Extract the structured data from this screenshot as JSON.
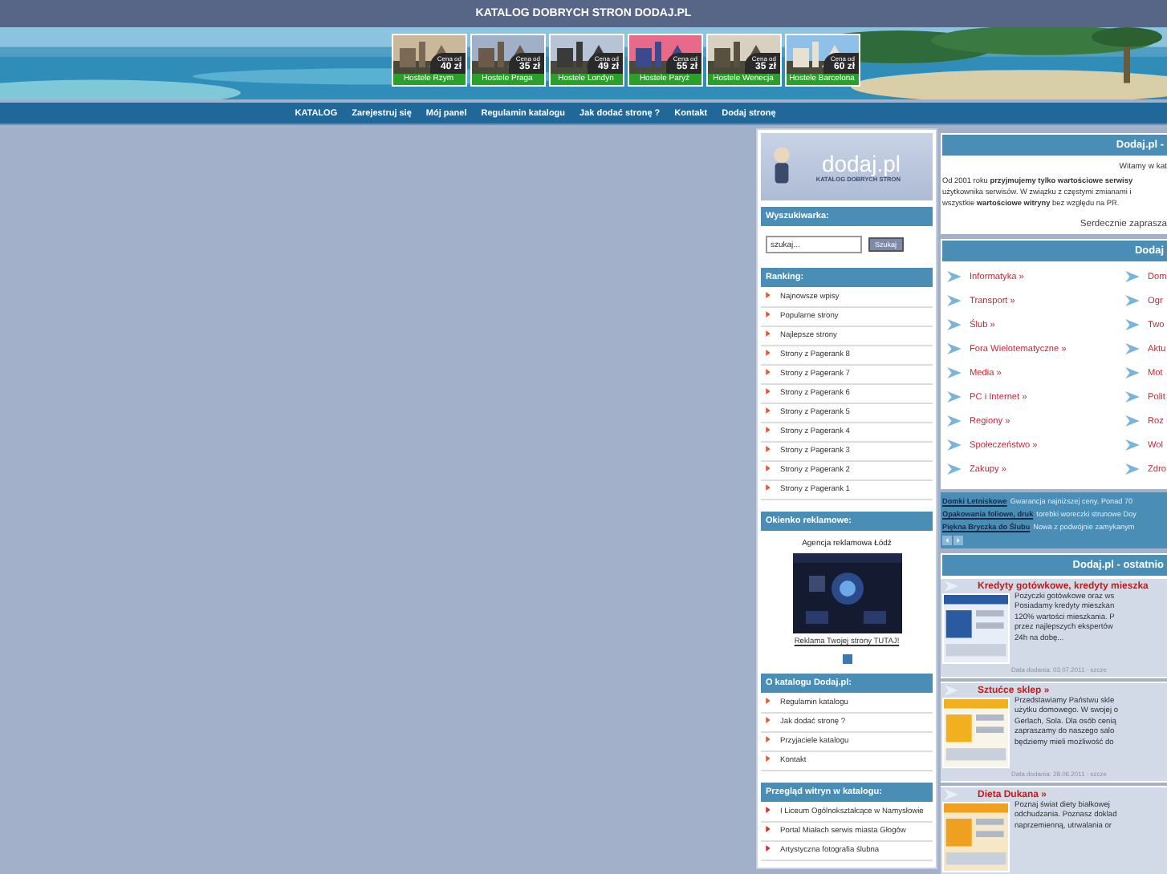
{
  "header": {
    "title": "KATALOG DOBRYCH STRON DODAJ.PL",
    "hostels": [
      {
        "price_label": "Cena od",
        "price": "40 zł",
        "label": "Hostele Rzym"
      },
      {
        "price_label": "Cena od",
        "price": "35 zł",
        "label": "Hostele Praga"
      },
      {
        "price_label": "Cena od",
        "price": "49 zł",
        "label": "Hostele Londyn"
      },
      {
        "price_label": "Cena od",
        "price": "55 zł",
        "label": "Hostele Paryż"
      },
      {
        "price_label": "Cena od",
        "price": "35 zł",
        "label": "Hostele Wenecja"
      },
      {
        "price_label": "Cena od",
        "price": "60 zł",
        "label": "Hostele Barcelona"
      }
    ]
  },
  "nav": [
    "KATALOG",
    "Zarejestruj się",
    "Mój panel",
    "Regulamin katalogu",
    "Jak dodać stronę ?",
    "Kontakt",
    "Dodaj stronę"
  ],
  "sidebar": {
    "logo": {
      "name": "dodaj.pl",
      "tagline": "KATALOG DOBRYCH STRON"
    },
    "search": {
      "heading": "Wyszukiwarka:",
      "placeholder": "szukaj...",
      "button": "Szukaj"
    },
    "ranking": {
      "heading": "Ranking:",
      "items": [
        "Najnowsze wpisy",
        "Popularne strony",
        "Najlepsze strony",
        "Strony z Pagerank 8",
        "Strony z Pagerank 7",
        "Strony z Pagerank 6",
        "Strony z Pagerank 5",
        "Strony z Pagerank 4",
        "Strony z Pagerank 3",
        "Strony z Pagerank 2",
        "Strony z Pagerank 1"
      ]
    },
    "ad": {
      "heading": "Okienko reklamowe:",
      "caption": "Agencja reklamowa Łódź",
      "link": "Reklama Twojej strony TUTAJ!"
    },
    "about": {
      "heading": "O katalogu Dodaj.pl:",
      "items": [
        "Regulamin katalogu",
        "Jak dodać stronę ?",
        "Przyjaciele katalogu",
        "Kontakt"
      ]
    },
    "review": {
      "heading": "Przegląd witryn w katalogu:",
      "items": [
        "I Liceum Ogólnokształcące w Namysłowie",
        "Portal Miałach serwis miasta Głogów",
        "Artystyczna fotografia ślubna"
      ]
    }
  },
  "main": {
    "welcome": {
      "heading": "Dodaj.pl -",
      "greeting": "Witamy w kat",
      "text": "Od 2001 roku **przyjmujemy tylko wartościowe serwisy**\nużytkownika serwisów. W związku z częstymi zmianami i\nwszystkie **wartościowe witryny** bez względu na PR.",
      "closing": "Serdecznie zaprasza"
    },
    "categories": {
      "heading": "Dodaj",
      "left": [
        "Informatyka »",
        "Transport »",
        "Ślub »",
        "Fora Wielotematyczne »",
        "Media »",
        "PC i Internet »",
        "Regiony »",
        "Społeczeństwo »",
        "Zakupy »"
      ],
      "right": [
        "Dom",
        "Ogr",
        "Two",
        "Aktu",
        "Mot",
        "Polit",
        "Roz",
        "Wol",
        "Zdro"
      ]
    },
    "sponsored": [
      {
        "link": "Domki Letniskowe",
        "text": "Gwarancja najniższej ceny. Ponad 70"
      },
      {
        "link": "Opakowania foliowe, druk",
        "text": "torebki woreczki strunowe Doy"
      },
      {
        "link": "Piękna Bryczka do Ślubu",
        "text": "Nowa z podwójnie zamykanym"
      }
    ],
    "latest": {
      "heading": "Dodaj.pl - ostatnio",
      "entries": [
        {
          "title": "Kredyty gotówkowe, kredyty mieszka",
          "text": "Pożyczki gotówkowe oraz ws\nPosiadamy kredyty mieszkan\n120% wartości mieszkania. P\nprzez najlepszych ekspertów\n24h na dobę...",
          "date": "Data dodania: 03.07.2011 · szcze"
        },
        {
          "title": "Sztućce sklep »",
          "text": "Przedstawiamy Państwu skle\nużytku domowego. W swojej o\nGerlach, Sola. Dla osób cenią\nzapraszamy do naszego salo\nbędziemy mieli możliwość do",
          "date": "Data dodania: 28.06.2011 · szcze"
        },
        {
          "title": "Dieta Dukana »",
          "text": "Poznaj świat diety białkowej\nodchudzania. Poznasz doklad\nnaprzemienną, utrwalania or"
        }
      ]
    }
  }
}
